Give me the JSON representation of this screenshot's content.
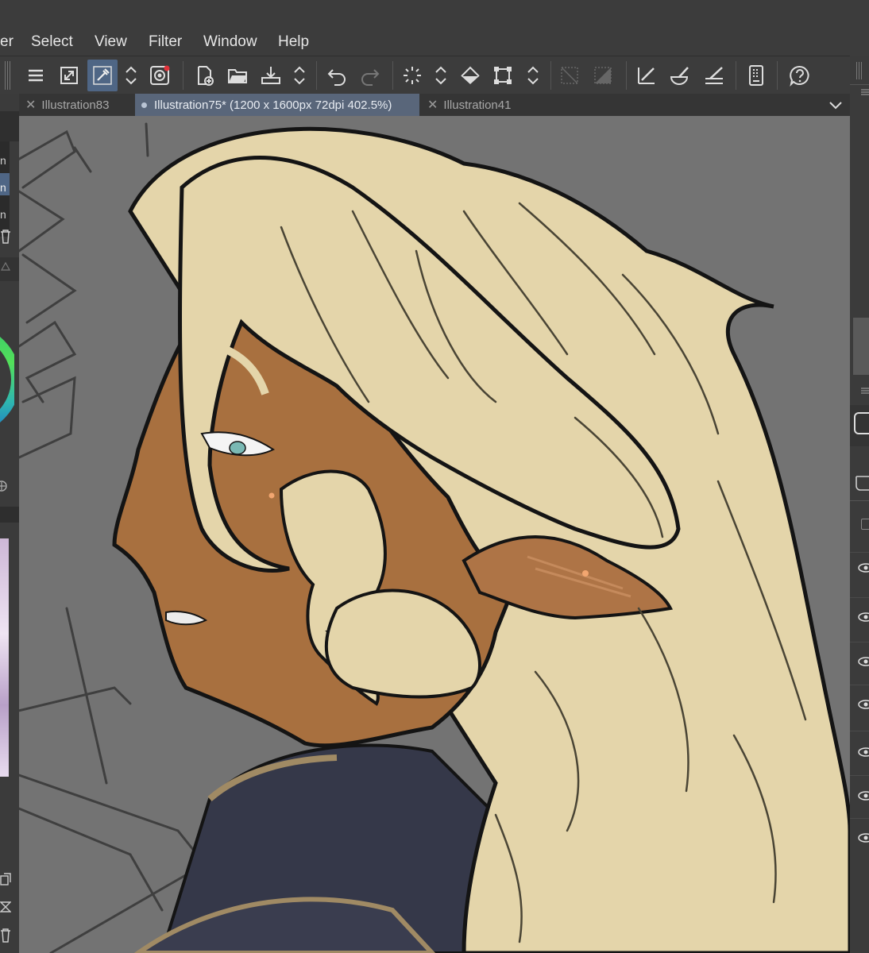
{
  "menubar": {
    "items": [
      "er",
      "Select",
      "View",
      "Filter",
      "Window",
      "Help"
    ]
  },
  "toolbar": {
    "buttons": [
      "menu-icon",
      "fit-view-icon",
      "color-picker-icon",
      "stepper-icon",
      "ring-layer-icon",
      "new-file-icon",
      "open-folder-icon",
      "save-icon",
      "stepper-icon",
      "undo-icon",
      "redo-icon",
      "selection-icon",
      "stepper-icon",
      "fill-icon",
      "transform-icon",
      "stepper-icon",
      "clear-icon",
      "layer-clear-icon",
      "ruler-pen-icon",
      "brush-icon",
      "ruler-icon",
      "device-icon",
      "help-icon"
    ]
  },
  "tabs": [
    {
      "label": "Illustration83",
      "active": false,
      "closable": true
    },
    {
      "label": "Illustration75* (1200 x 1600px 72dpi 402.5%)",
      "active": true,
      "closable": false
    },
    {
      "label": "Illustration41",
      "active": false,
      "closable": true
    }
  ],
  "left_panel": {
    "fragments": [
      "n",
      "n",
      "n"
    ]
  },
  "colors": {
    "accent": "#4f6685",
    "canvas_bg": "#737373",
    "hair": "#e4d5aa",
    "skin": "#a8703f",
    "coat": "#353849"
  }
}
